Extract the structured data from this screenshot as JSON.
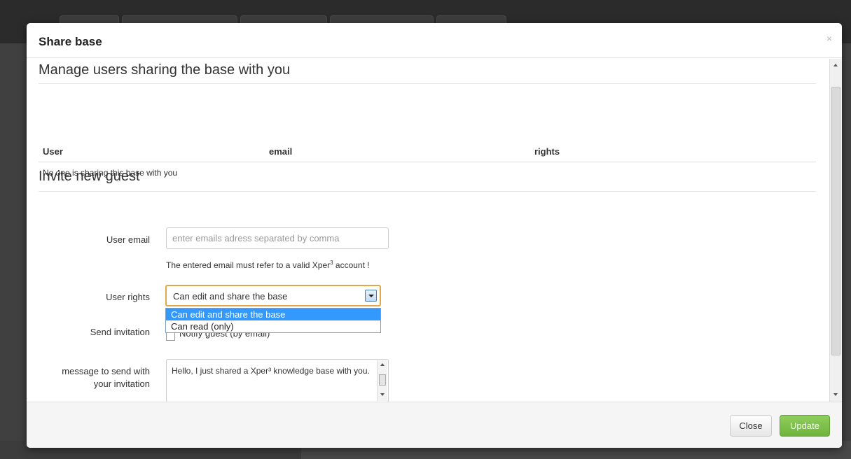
{
  "modal": {
    "title": "Share base",
    "close_glyph": "×"
  },
  "sharing_section": {
    "heading": "Manage users sharing the base with you",
    "columns": [
      "User",
      "email",
      "rights"
    ],
    "empty_message": "No one is sharing this base with you"
  },
  "invite_section": {
    "heading": "Invite new guest",
    "email_label": "User email",
    "email_placeholder": "enter emails adress separated by comma",
    "email_value": "",
    "email_help_prefix": "The entered email must refer to a valid Xper",
    "email_help_sup": "3",
    "email_help_suffix": " account !",
    "rights_label": "User rights",
    "rights_selected": "Can edit and share the base",
    "rights_options": [
      "Can edit and share the base",
      "Can read (only)"
    ],
    "invitation_label": "Send invitation",
    "invitation_checkbox_label": "Notify guest (by email)",
    "invitation_checked": false,
    "message_label_line1": "message to send with",
    "message_label_line2": "your invitation",
    "message_value": "Hello, I just shared a Xper³ knowledge base with you."
  },
  "footer": {
    "close_label": "Close",
    "update_label": "Update"
  },
  "colors": {
    "update_button": "#7cc04a",
    "selected_option": "#3399ff",
    "select_focus_border": "#e0a84a"
  }
}
